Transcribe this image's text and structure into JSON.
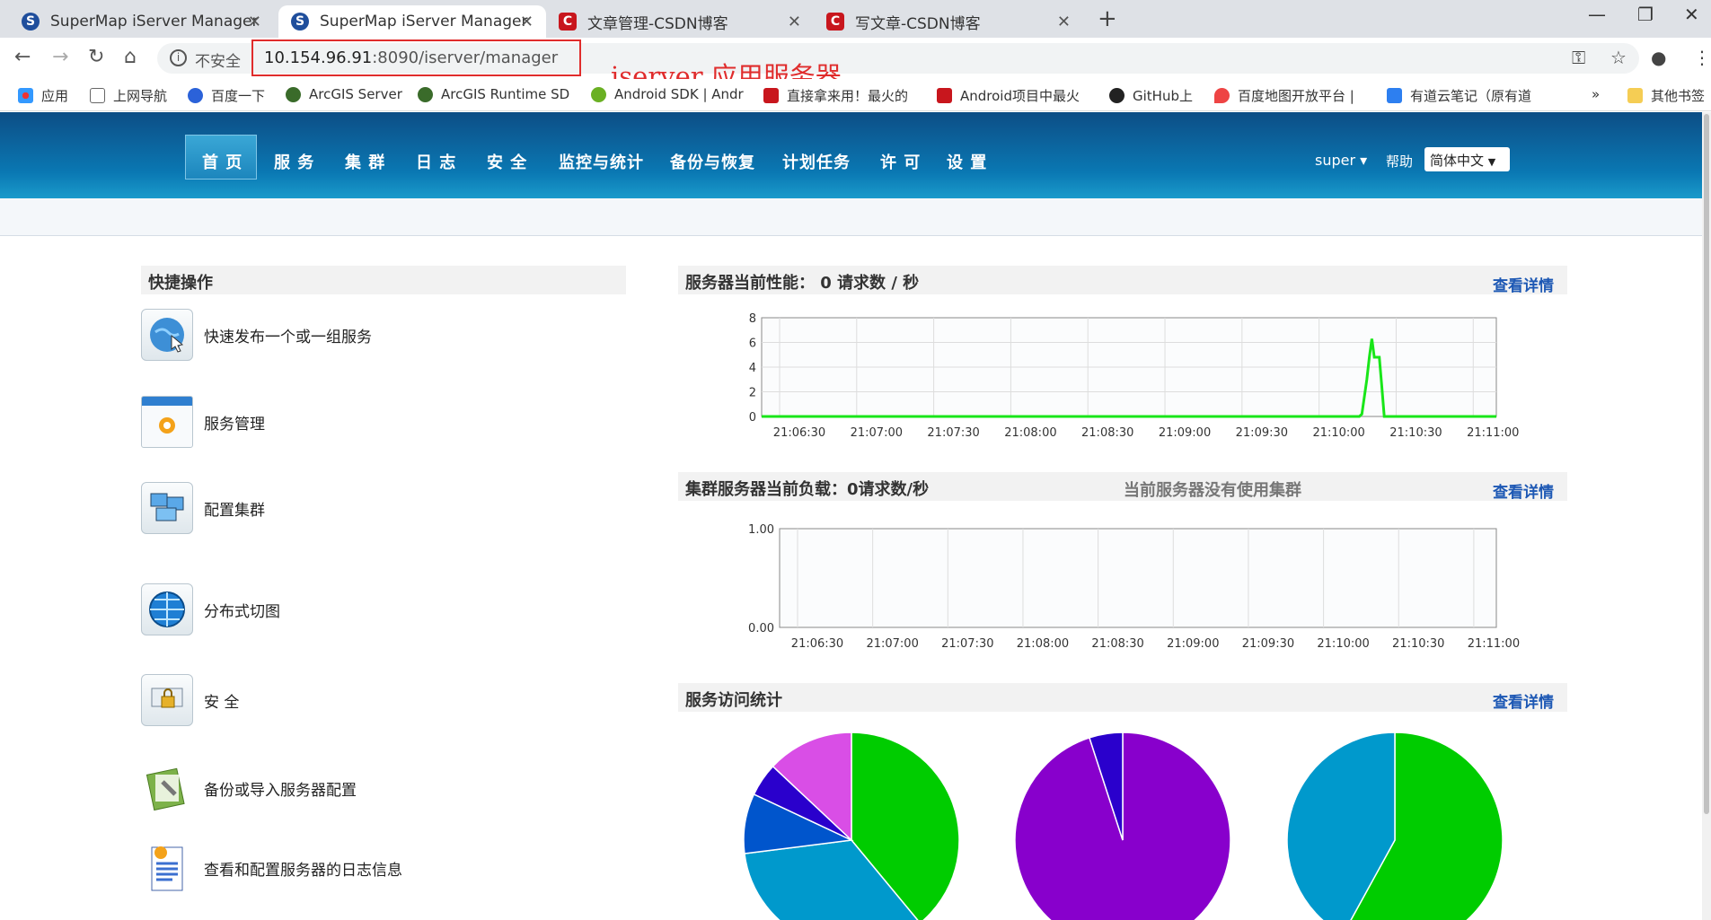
{
  "browser": {
    "tabs": [
      {
        "title": "SuperMap iServer Manager",
        "favicon": "supermap-icon",
        "active": false
      },
      {
        "title": "SuperMap iServer Manager",
        "favicon": "supermap-icon",
        "active": true
      },
      {
        "title": "文章管理-CSDN博客",
        "favicon": "csdn-icon",
        "active": false
      },
      {
        "title": "写文章-CSDN博客",
        "favicon": "csdn-icon",
        "active": false
      }
    ],
    "security_label": "不安全",
    "url_host": "10.154.96.91",
    "url_rest": ":8090/iserver/manager",
    "annotation": "iserver 应用服务器",
    "bookmarks": [
      "应用",
      "上网导航",
      "百度一下",
      "ArcGIS Server",
      "ArcGIS Runtime SD",
      "Android SDK | Andr",
      "直接拿来用！最火的",
      "Android项目中最火",
      "GitHub上",
      "百度地图开放平台 | ",
      "有道云笔记（原有道",
      "»",
      "其他书签"
    ]
  },
  "header": {
    "nav": [
      "首 页",
      "服 务",
      "集 群",
      "日 志",
      "安 全",
      "监控与统计",
      "备份与恢复",
      "计划任务",
      "许 可",
      "设 置"
    ],
    "user": "super",
    "help": "帮助",
    "language": "简体中文"
  },
  "quick_ops": {
    "title": "快捷操作",
    "items": [
      {
        "label": "快速发布一个或一组服务",
        "icon": "globe-publish-icon"
      },
      {
        "label": "服务管理",
        "icon": "service-gear-icon"
      },
      {
        "label": "配置集群",
        "icon": "cluster-computers-icon"
      },
      {
        "label": "分布式切图",
        "icon": "globe-tiles-icon"
      },
      {
        "label": "安 全",
        "icon": "security-lock-icon"
      },
      {
        "label": "备份或导入服务器配置",
        "icon": "backup-tools-icon"
      },
      {
        "label": "查看和配置服务器的日志信息",
        "icon": "log-document-icon"
      }
    ]
  },
  "perf": {
    "title": "服务器当前性能：  0 请求数 / 秒",
    "detail": "查看详情"
  },
  "cluster": {
    "title": "集群服务器当前负载：0请求数/秒",
    "status": "当前服务器没有使用集群",
    "detail": "查看详情"
  },
  "stats": {
    "title": "服务访问统计",
    "detail": "查看详情"
  },
  "chart_data": [
    {
      "type": "line",
      "x_ticks": [
        "21:06:30",
        "21:07:00",
        "21:07:30",
        "21:08:00",
        "21:08:30",
        "21:09:00",
        "21:09:30",
        "21:10:00",
        "21:10:30",
        "21:11:00"
      ],
      "y_ticks": [
        "0",
        "2",
        "4",
        "6",
        "8"
      ],
      "ylim": [
        0,
        8
      ],
      "grid": true,
      "color": "#19e619",
      "series": [
        {
          "x": [
            0,
            240,
            241,
            243,
            244,
            245,
            246,
            248,
            249,
            250,
            295
          ],
          "y": [
            0,
            0,
            0.2,
            3,
            4.8,
            6.3,
            4.8,
            4.8,
            2.5,
            0,
            0
          ]
        }
      ]
    },
    {
      "type": "line",
      "x_ticks": [
        "21:06:30",
        "21:07:00",
        "21:07:30",
        "21:08:00",
        "21:08:30",
        "21:09:00",
        "21:09:30",
        "21:10:00",
        "21:10:30",
        "21:11:00"
      ],
      "y_ticks": [
        "0.00",
        "1.00"
      ],
      "ylim": [
        0,
        1
      ],
      "grid": true,
      "series": []
    },
    {
      "type": "pie",
      "values": [
        39,
        34,
        9,
        5,
        13
      ],
      "colors": [
        "#00cc00",
        "#0099cc",
        "#0055cc",
        "#2a00cc",
        "#d94ee6"
      ]
    },
    {
      "type": "pie",
      "values": [
        95,
        5
      ],
      "colors": [
        "#8800cc",
        "#2a00cc"
      ]
    },
    {
      "type": "pie",
      "values": [
        58,
        42
      ],
      "colors": [
        "#00cc00",
        "#0099cc"
      ]
    }
  ]
}
